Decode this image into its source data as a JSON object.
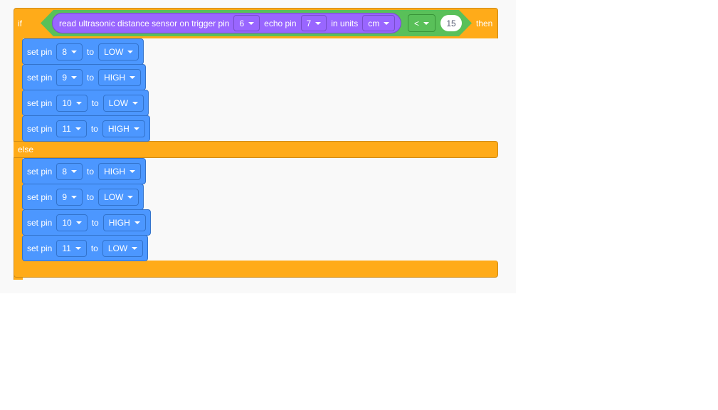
{
  "if_block": {
    "if_label": "if",
    "then_label": "then",
    "else_label": "else",
    "color": "#ffab19",
    "condition": {
      "sensor_label": "read ultrasonic distance sensor on trigger pin",
      "trigger_pin": "6",
      "echo_label": "echo pin",
      "echo_pin": "7",
      "units_label": "in units",
      "units": "cm",
      "operator": "<",
      "value": "15"
    }
  },
  "then_statements": [
    {
      "label": "set pin",
      "pin": "8",
      "to": "to",
      "state": "LOW"
    },
    {
      "label": "set pin",
      "pin": "9",
      "to": "to",
      "state": "HIGH"
    },
    {
      "label": "set pin",
      "pin": "10",
      "to": "to",
      "state": "LOW"
    },
    {
      "label": "set pin",
      "pin": "11",
      "to": "to",
      "state": "HIGH"
    }
  ],
  "else_statements": [
    {
      "label": "set pin",
      "pin": "8",
      "to": "to",
      "state": "HIGH"
    },
    {
      "label": "set pin",
      "pin": "9",
      "to": "to",
      "state": "LOW"
    },
    {
      "label": "set pin",
      "pin": "10",
      "to": "to",
      "state": "HIGH"
    },
    {
      "label": "set pin",
      "pin": "11",
      "to": "to",
      "state": "LOW"
    }
  ]
}
